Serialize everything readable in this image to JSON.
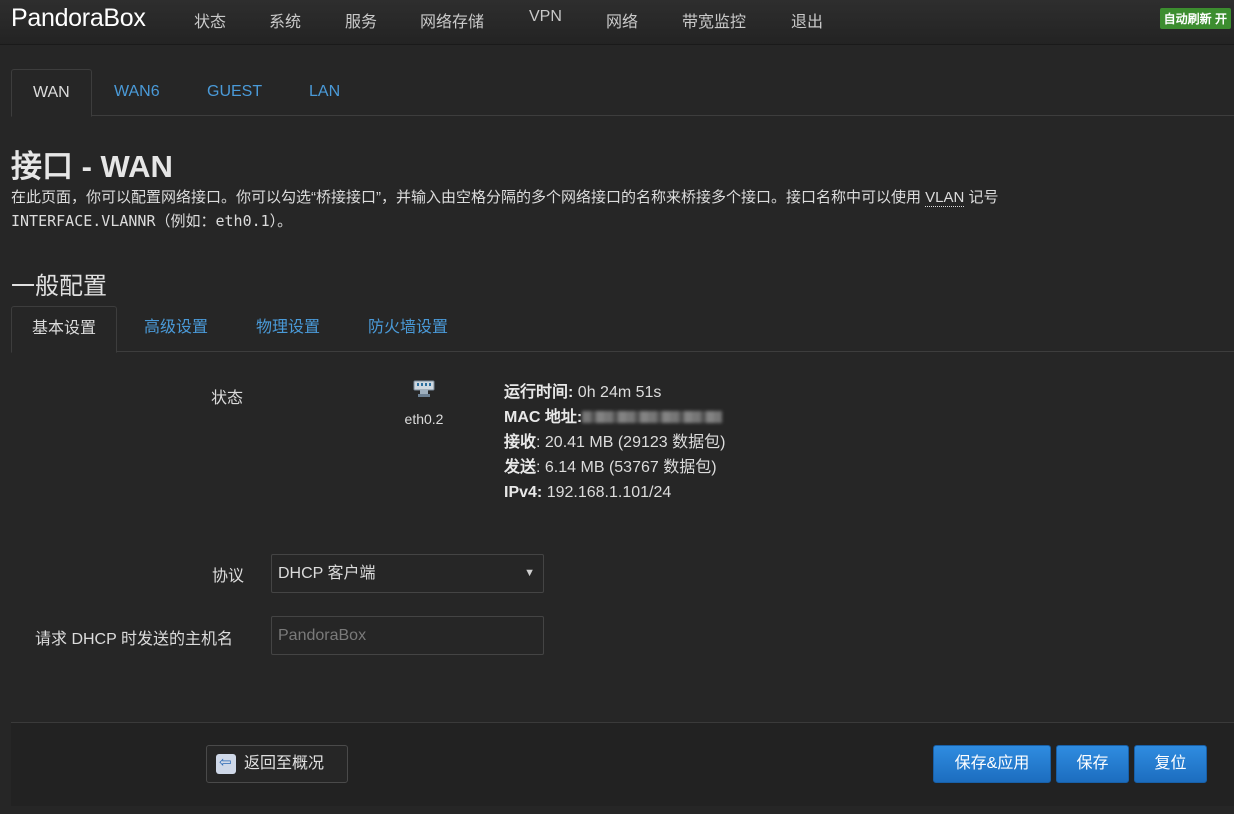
{
  "header": {
    "brand": "PandoraBox",
    "nav": [
      "状态",
      "系统",
      "服务",
      "网络存储",
      "VPN",
      "网络",
      "带宽监控",
      "退出"
    ],
    "auto_refresh": "自动刷新 开"
  },
  "tabs": [
    "WAN",
    "WAN6",
    "GUEST",
    "LAN"
  ],
  "page": {
    "title": "接口 - WAN",
    "description_part1": "在此页面，你可以配置网络接口。你可以勾选“桥接接口”，并输入由空格分隔的多个网络接口的名称来桥接多个接口。接口名称中可以使用 ",
    "description_abbr": "VLAN",
    "description_part2": " 记号",
    "description_line2": "INTERFACE.VLANNR（例如：eth0.1）。"
  },
  "section": {
    "title": "一般配置",
    "subtabs": [
      "基本设置",
      "高级设置",
      "物理设置",
      "防火墙设置"
    ]
  },
  "status": {
    "label": "状态",
    "interface_name": "eth0.2",
    "uptime_label": "运行时间:",
    "uptime_value": "0h 24m 51s",
    "mac_label": "MAC 地址:",
    "rx_label": "接收",
    "rx_value": ": 20.41 MB (29123 数据包)",
    "tx_label": "发送",
    "tx_value": ": 6.14 MB (53767 数据包)",
    "ipv4_label": "IPv4:",
    "ipv4_value": "192.168.1.101/24"
  },
  "protocol": {
    "label": "协议",
    "value": "DHCP 客户端"
  },
  "hostname": {
    "label": "请求 DHCP 时发送的主机名",
    "placeholder": "PandoraBox"
  },
  "footer": {
    "back": "返回至概况",
    "save_apply": "保存&应用",
    "save": "保存",
    "reset": "复位"
  }
}
